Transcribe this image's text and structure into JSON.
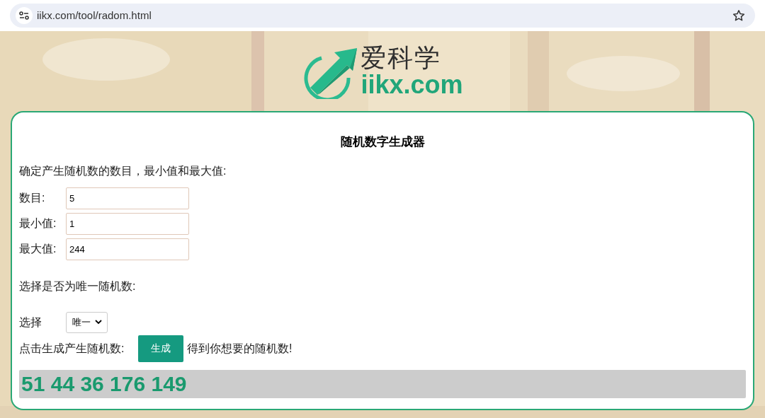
{
  "address_bar": {
    "url": "iikx.com/tool/radom.html"
  },
  "logo": {
    "name": "爱科学",
    "domain": "iikx.com"
  },
  "tool": {
    "title": "随机数字生成器",
    "intro": "确定产生随机数的数目，最小值和最大值:",
    "fields": [
      {
        "label": "数目:",
        "value": "5"
      },
      {
        "label": "最小值:",
        "value": "1"
      },
      {
        "label": "最大值:",
        "value": "244"
      }
    ],
    "unique_prompt": "选择是否为唯一随机数:",
    "select": {
      "label": "选择",
      "value": "唯一"
    },
    "generate": {
      "prompt": "点击生成产生随机数:",
      "button": "生成",
      "after": "得到你想要的随机数!"
    },
    "result": "51 44 36 176 149"
  }
}
